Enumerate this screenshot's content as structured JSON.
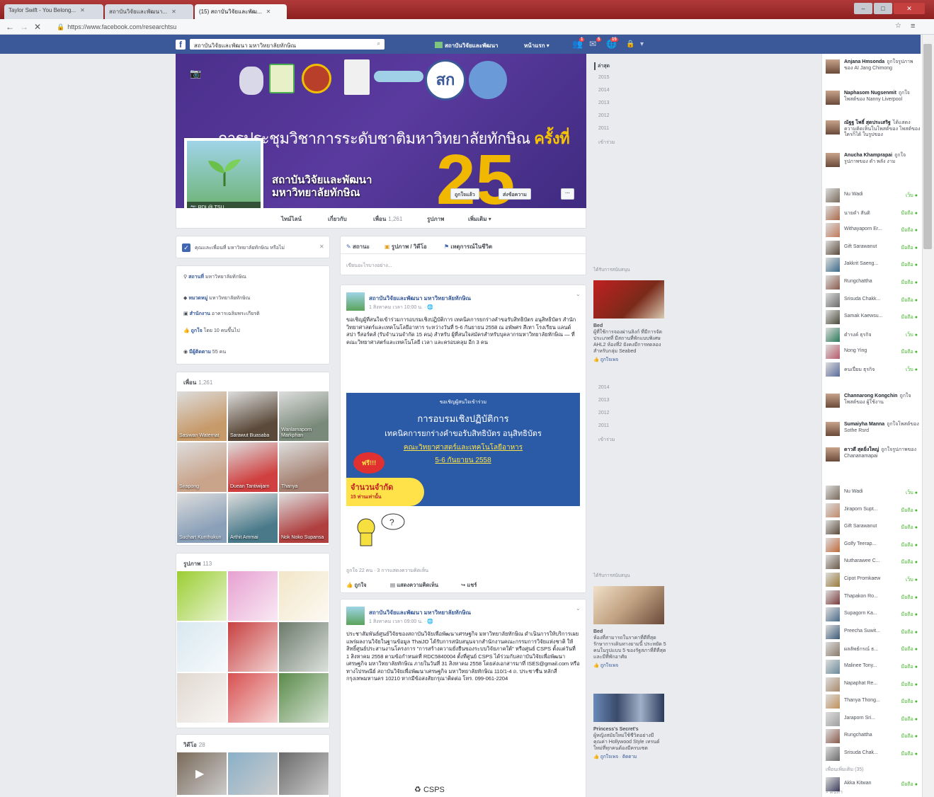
{
  "browser": {
    "tabs": [
      {
        "title": "Taylor Swift - You Belong...",
        "active": false
      },
      {
        "title": "สถาบันวิจัยและพัฒนา...",
        "active": false
      },
      {
        "title": "(15) สถาบันวิจัยและพัฒ...",
        "active": true
      }
    ],
    "url": "https://www.facebook.com/researchtsu",
    "window_controls": [
      "–",
      "□",
      "✕"
    ]
  },
  "fb_header": {
    "logo": "f",
    "search_value": "สถาบันวิจัยและพัฒนา มหาวิทยาลัยทักษิณ",
    "nav_page": "สถาบันวิจัยและพัฒนา",
    "nav_home": "หน้าแรก",
    "badges": {
      "friends": "1",
      "messages": "5",
      "notifications": "15"
    }
  },
  "cover": {
    "headline_1": "การประชุมวิชาการระดับชาติมหาวิทยาลัยทักษิณ",
    "headline_2": "ครั้งที่",
    "number": "25",
    "logo_text": "สก",
    "profile_bar": "RDI @ TSU",
    "page_name_1": "สถาบันวิจัยและพัฒนา",
    "page_name_2": "มหาวิทยาลัยทักษิณ",
    "btn_liked": "ถูกใจแล้ว",
    "btn_message": "ส่งข้อความ",
    "btn_more": "···"
  },
  "page_tabs": [
    {
      "label": "ไทม์ไลน์",
      "count": ""
    },
    {
      "label": "เกี่ยวกับ",
      "count": ""
    },
    {
      "label": "เพื่อน",
      "count": "1,261"
    },
    {
      "label": "รูปภาพ",
      "count": ""
    },
    {
      "label": "เพิ่มเติม ▾",
      "count": ""
    }
  ],
  "left": {
    "checkin": "คุณและเพื่อนที่ มหาวิทยาลัยทักษิณ หรือไม่",
    "about": [
      {
        "label": "สถานที่",
        "value": "มหาวิทยาลัยทักษิณ"
      },
      {
        "label": "หมวดหมู่",
        "value": "มหาวิทยาลัยทักษิณ"
      },
      {
        "label": "สำนักงาน",
        "value": "อาคารเฉลิมพระเกียรติ"
      },
      {
        "label": "ถูกใจ",
        "value": "โดย 10 คนขึ้นไป"
      },
      {
        "label": "มีผู้ติดตาม",
        "value": "55 คน"
      }
    ],
    "friends_title": "เพื่อน",
    "friends_count": "1,261",
    "friends": [
      {
        "name": "Sasiwan Waternat",
        "c": "#c79a6a"
      },
      {
        "name": "Sarawut Buasaba",
        "c": "#5b4a3a"
      },
      {
        "name": "Wanlamaporn Markphan",
        "c": "#7a8a7a"
      },
      {
        "name": "Sirapong",
        "c": "#c9a38a"
      },
      {
        "name": "Duean Tantiwijarn",
        "c": "#d04040"
      },
      {
        "name": "Thanya",
        "c": "#a58070"
      },
      {
        "name": "Suchart Kunthukun",
        "c": "#8aa0b8"
      },
      {
        "name": "Arthit Ammai",
        "c": "#4a7a8a"
      },
      {
        "name": "Nok Noko Supansa",
        "c": "#b04040"
      }
    ],
    "photos_title": "รูปภาพ",
    "photos_count": "113",
    "photos": [
      "#9acd32",
      "#e6a0d0",
      "#f2e6c8",
      "#d8e8f0",
      "#c84040",
      "#6a7a6a",
      "#e0d8d0",
      "#d85050",
      "#5a8a4a"
    ],
    "videos_title": "วิดีโอ",
    "videos_count": "28",
    "videos": [
      "#7a6a5a",
      "#8ab0c8",
      "#6a6a6a"
    ]
  },
  "composer": {
    "status": "สถานะ",
    "photo": "รูปภาพ / วิดีโอ",
    "event": "เหตุการณ์ในชีวิต",
    "placeholder": "เขียนอะไรบางอย่าง..."
  },
  "post1": {
    "author": "สถาบันวิจัยและพัฒนา มหาวิทยาลัยทักษิณ",
    "time": "1 สิงหาคม เวลา 10:00 น. · 🌐",
    "text": "ขอเชิญผู้ที่สนใจเข้าร่วมการอบรมเชิงปฏิบัติการ เทคนิคการยกร่างคำขอรับสิทธิบัตร อนุสิทธิบัตร สำนักวิทยาศาสตร์และเทคโนโลยีอาหาร ระหว่างวันที่ 5-6 กันยายน 2558 ณ อพัพศร สีเทา โรงเรียน แลนด์ สปา รีสอร์ตส์ (รับจำนวนจำกัด 15 คน) สำหรับ ผู้ที่สนใจสมัครสำหรับบุคลากรมหาวิทยาลัยทักษิณ — ที่ คณะวิทยาศาสตร์และเทคโนโลยี เวลา และครอบคลุม อีก 3 คน",
    "poster_top": "ขอเชิญผู้สนใจเข้าร่วม",
    "poster_title": "การอบรมเชิงปฏิบัติการ",
    "poster_sub": "เทคนิคการยกร่างคำขอรับสิทธิบัตร อนุสิทธิบัตร",
    "poster_org": "คณะวิทยาศาสตร์และเทคโนโลยีอาหาร",
    "poster_date": "5-6 กันยายน 2558",
    "poster_free": "ฟรี!!!",
    "poster_limited": "จำนวนจำกัด",
    "poster_limited2": "15 ท่านเท่านั้น",
    "likes": "ถูกใจ 22 คน · 3 การแสดงความคิดเห็น",
    "a_like": "ถูกใจ",
    "a_comment": "แสดงความคิดเห็น",
    "a_share": "แชร์"
  },
  "post2": {
    "author": "สถาบันวิจัยและพัฒนา มหาวิทยาลัยทักษิณ",
    "time": "1 สิงหาคม เวลา 09:00 น. · 🌐",
    "text": "ประชาสัมพันธ์ศูนย์วิจัยของสถาบันวิจัยเพื่อพัฒนาเศรษฐกิจ มหาวิทยาลัยทักษิณ ดำเนินการให้บริการเผยแพร่ผลงานวิจัยในฐานข้อมูล ThaiJO ได้รับการสนับสนุนจากสำนักงานคณะกรรมการวิจัยแห่งชาติ ให้สิทธิ์ศูนย์ประสานงานโครงการ \"การสร้างความยั่งยืนของระบบวิจัยภาคใต้\" หรือศูนย์ CSPS ตั้งแต่วันที่ 1 สิงหาคม 2558 ตามข้อกำหนดที่ RDC5840004 ตั้งที่ศูนย์ CSPS ได้ร่วมกับสถาบันวิจัยเพื่อพัฒนาเศรษฐกิจ มหาวิทยาลัยทักษิณ ภายในวันที่ 31 สิงหาคม 2558 โดยส่งเอกสารมาที่ ISES@gmail.com หรือทางไปรษณีย์ สถาบันวิจัยเพื่อพัฒนาเศรษฐกิจ มหาวิทยาลัยทักษิณ 110/1-4 ถ. ประชาชื่น หลักสี่ กรุงเทพมหานคร 10210 หากมีข้อสงสัยกรุณาติดต่อ โทร. 099-061-2204",
    "footer_logo": "CSPS"
  },
  "years": [
    "ล่าสุด",
    "2015",
    "2014",
    "2013",
    "2012",
    "2011",
    "เข้าร่วม"
  ],
  "years2": [
    "2014",
    "2013",
    "2012",
    "2011",
    "เข้าร่วม"
  ],
  "ads": [
    {
      "head": "ได้รับการสนับสนุน",
      "title": "Bed",
      "text": "ผู้ที่ใช้การจองผ่านลิงก์ ที่มีการจัดประเภทที่ มีสถานที่พักแบบพิเศษ AHL2 ห้องที่2 ยังคงมีการทดลอง สำหรับกลุ่ม Seabed",
      "like": "ถูกใจเพจ"
    },
    {
      "head": "ได้รับการสนับสนุน",
      "title": "Bed",
      "text": "ห้องที่สามารถในราคาที่ดีที่สุด รักษาการเดินทางยามนี้ ประหยัด 5 คนในรูปแบบ 5 ของรัฐสภาที่ดีที่สุดและมีที่พักอาศัย",
      "like": "ถูกใจเพจ"
    },
    {
      "head": "",
      "title": "Princess's Secret's",
      "text": "ผู้หญิงสมัยใหม่ใช้ชีวิตอย่างมีคุณค่า Hollywood Style เทรนด์ใหม่ที่ทุกคนต้องมีครบเซต",
      "like": "ถูกใจเพจ · ติดตาม"
    }
  ],
  "chat_stories": [
    {
      "name": "Anjana Hmsonda",
      "text": "ถูกใจรูปภาพของ AI Jang Chimong"
    },
    {
      "name": "Naphasom Nugsenmit",
      "text": "ถูกใจโพสต์ของ Nanny Liverpool"
    },
    {
      "name": "ณัฐฐ โพธิ์ สุดประเสริฐ",
      "text": "ได้แสดงความคิดเห็นในโพสต์ของ โพสต์ของ ใครก็ได้ ในรูปของ"
    },
    {
      "name": "Anucha Khamprapai",
      "text": "ถูกใจรูปภาพของ ดำ พลัง งาม"
    }
  ],
  "chat_contacts_a": [
    {
      "name": "Nu Wadi",
      "status": "เว็บ",
      "c": "#7a6a5a"
    },
    {
      "name": "นายดำ สันติ",
      "status": "มือถือ",
      "c": "#aa6a4a"
    },
    {
      "name": "Withayaporn Er...",
      "status": "มือถือ",
      "c": "#c07a5a"
    },
    {
      "name": "Gift Sarawanut",
      "status": "มือถือ",
      "c": "#5a4a3a"
    },
    {
      "name": "Jakkrit Saeng...",
      "status": "มือถือ",
      "c": "#3a6a8a"
    },
    {
      "name": "Rungchattha",
      "status": "มือถือ",
      "c": "#8a5a4a"
    },
    {
      "name": "Srisuda Chakk...",
      "status": "มือถือ",
      "c": "#6a6a6a"
    },
    {
      "name": "Samak Kaewsu...",
      "status": "มือถือ",
      "c": "#4a4a3a"
    },
    {
      "name": "ดำรงค์ ธุรกิจ",
      "status": "เว็บ",
      "c": "#2a7a5a"
    },
    {
      "name": "Nong Ying",
      "status": "มือถือ",
      "c": "#b85a6a"
    },
    {
      "name": "คนเปี่ยม ธุรกิจ",
      "status": "เว็บ",
      "c": "#5a6a9a"
    }
  ],
  "chat_stories_b": [
    {
      "name": "Channarong Kongchin",
      "text": "ถูกใจโพสต์ของ ผู้ใช้งาน"
    },
    {
      "name": "Sumaiyha Manna",
      "text": "ถูกใจโพสต์ของ Sothe Rsrd"
    },
    {
      "name": "ดาวดี สุดยิ่งใหญ่",
      "text": "ถูกใจรูปภาพของ Chananamapai"
    }
  ],
  "chat_contacts_b": [
    {
      "name": "Nu Wadi",
      "status": "เว็บ",
      "c": "#7a6a5a"
    },
    {
      "name": "Jiraporn Supt...",
      "status": "มือถือ",
      "c": "#c08a6a"
    },
    {
      "name": "Gift Sarawanut",
      "status": "มือถือ",
      "c": "#5a4a3a"
    },
    {
      "name": "Golfy Teerap...",
      "status": "มือถือ",
      "c": "#c06a3a"
    },
    {
      "name": "Nutharawee C...",
      "status": "มือถือ",
      "c": "#6a5a4a"
    },
    {
      "name": "Cipot Promkaew",
      "status": "เว็บ",
      "c": "#9a7a3a"
    },
    {
      "name": "Thapakon Ro...",
      "status": "มือถือ",
      "c": "#7a3a3a"
    },
    {
      "name": "Supagorn Ka...",
      "status": "มือถือ",
      "c": "#4a6a8a"
    },
    {
      "name": "Preecha Suwit...",
      "status": "มือถือ",
      "c": "#3a5a7a"
    },
    {
      "name": "ผลลัพธ์กรณ์ ธ...",
      "status": "มือถือ",
      "c": "#8a7a6a"
    },
    {
      "name": "Malinee Tony...",
      "status": "มือถือ",
      "c": "#6a8a9a"
    },
    {
      "name": "Napaphat Re...",
      "status": "มือถือ",
      "c": "#aa8a6a"
    },
    {
      "name": "Thanya Thong...",
      "status": "มือถือ",
      "c": "#c0905a"
    },
    {
      "name": "Jaraporn Sri...",
      "status": "มือถือ",
      "c": "#a0a0a0"
    },
    {
      "name": "Rungchattha",
      "status": "มือถือ",
      "c": "#8a5a4a"
    },
    {
      "name": "Srisuda Chak...",
      "status": "มือถือ",
      "c": "#6a6a6a"
    }
  ],
  "chat_more": "เพื่อนเพิ่มเติม (35)",
  "chat_last": {
    "name": "Akka Kitwan",
    "status": "มือถือ",
    "c": "#3a3a5a"
  },
  "chat_search": "ค้นหา"
}
